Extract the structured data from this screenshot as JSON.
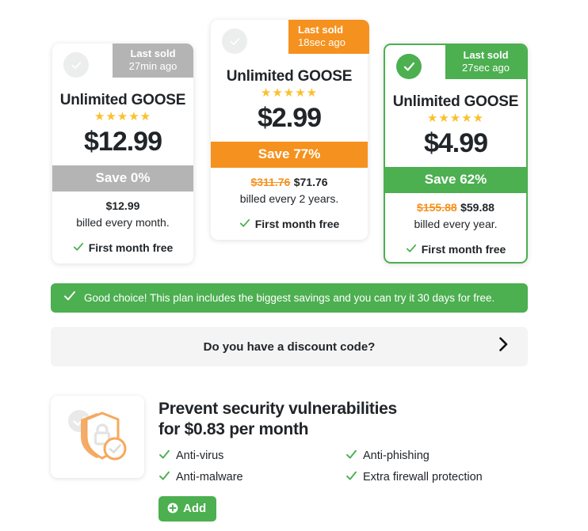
{
  "plans": [
    {
      "id": "card-1",
      "selected": false,
      "theme": "grey",
      "last_sold_label": "Last sold",
      "last_sold_time": "27min ago",
      "name": "Unlimited GOOSE",
      "stars": "★★★★★",
      "price": "$12.99",
      "save_label": "Save 0%",
      "old_total": "",
      "total": "$12.99",
      "billed_cycle": "billed every month.",
      "first_month_free": "First month free"
    },
    {
      "id": "card-2",
      "selected": false,
      "theme": "orange",
      "last_sold_label": "Last sold",
      "last_sold_time": "18sec ago",
      "name": "Unlimited GOOSE",
      "stars": "★★★★★",
      "price": "$2.99",
      "save_label": "Save 77%",
      "old_total": "$311.76",
      "total": "$71.76",
      "billed_cycle": "billed every 2 years.",
      "first_month_free": "First month free"
    },
    {
      "id": "card-3",
      "selected": true,
      "theme": "green",
      "last_sold_label": "Last sold",
      "last_sold_time": "27sec ago",
      "name": "Unlimited GOOSE",
      "stars": "★★★★★",
      "price": "$4.99",
      "save_label": "Save 62%",
      "old_total": "$155.88",
      "total": "$59.88",
      "billed_cycle": "billed every year.",
      "first_month_free": "First month free"
    }
  ],
  "good_choice": {
    "text": "Good choice! This plan includes the biggest savings and you can try it 30 days for free."
  },
  "discount": {
    "label": "Do you have a discount code?",
    "chevron": "❯"
  },
  "upsell": {
    "title_line1": "Prevent security vulnerabilities",
    "title_line2": "for $0.83 per month",
    "features": [
      "Anti-virus",
      "Anti-phishing",
      "Anti-malware",
      "Extra firewall protection"
    ],
    "add_label": "Add"
  },
  "colors": {
    "green": "#4caf50",
    "orange": "#f5911e",
    "grey": "#b4b4b4",
    "panel_grey": "#f4f4f4"
  }
}
